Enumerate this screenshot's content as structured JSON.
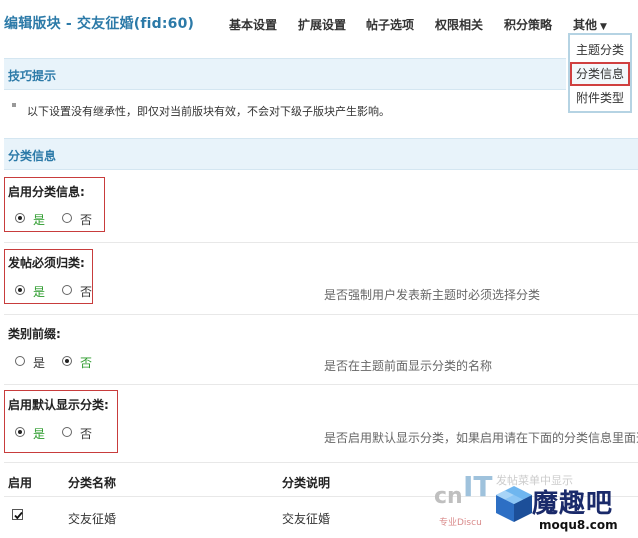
{
  "header": {
    "title": "编辑版块 - 交友征婚(fid:60)",
    "nav": [
      "基本设置",
      "扩展设置",
      "帖子选项",
      "权限相关",
      "积分策略",
      "其他"
    ]
  },
  "dropdown": {
    "items": [
      "主题分类",
      "分类信息",
      "附件类型"
    ],
    "selected": "分类信息"
  },
  "tips": {
    "title": "技巧提示",
    "text": "以下设置没有继承性，即仅对当前版块有效，不会对下级子版块产生影响。"
  },
  "category_section": {
    "title": "分类信息"
  },
  "settings": [
    {
      "label": "启用分类信息:",
      "yes": "是",
      "no": "否",
      "value": "是",
      "description": ""
    },
    {
      "label": "发帖必须归类:",
      "yes": "是",
      "no": "否",
      "value": "是",
      "description": "是否强制用户发表新主题时必须选择分类"
    },
    {
      "label": "类别前缀:",
      "yes": "是",
      "no": "否",
      "value": "否",
      "description": "是否在主题前面显示分类的名称"
    },
    {
      "label": "启用默认显示分类:",
      "yes": "是",
      "no": "否",
      "value": "是",
      "description": "是否启用默认显示分类，如果启用请在下面的分类信息里面选"
    }
  ],
  "table": {
    "headers": [
      "启用",
      "分类名称",
      "分类说明"
    ],
    "rows": [
      {
        "enabled": true,
        "name": "交友征婚",
        "description": "交友征婚"
      }
    ]
  },
  "watermark": {
    "faint_text": "发帖菜单中显示",
    "site_left_1": "cn",
    "site_left_2": "IT",
    "slogan": "专业Discu",
    "brand": "魔趣吧",
    "url": "moqu8.com"
  },
  "colors": {
    "accent": "#2c7aa8",
    "section_bg": "#e8f3fa",
    "highlight_red": "#c83c3c",
    "radio_green": "#2a9a2a"
  }
}
